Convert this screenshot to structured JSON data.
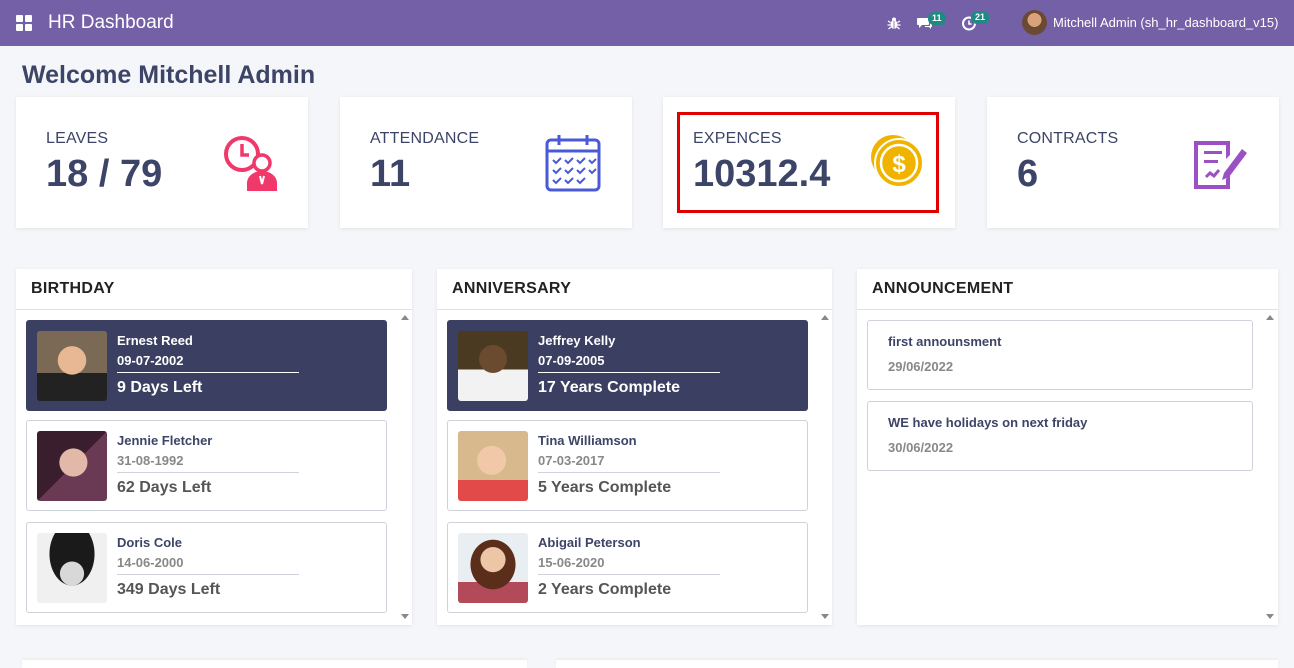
{
  "navbar": {
    "title": "HR Dashboard",
    "messages_count": "11",
    "activities_count": "21",
    "user": "Mitchell Admin (sh_hr_dashboard_v15)",
    "icons": [
      "apps-icon",
      "bug-icon",
      "chat-icon",
      "clock-icon"
    ]
  },
  "welcome": "Welcome Mitchell Admin",
  "stats": [
    {
      "label": "LEAVES",
      "value": "18 / 79",
      "icon": "leave-person-clock-icon",
      "color": "#f0386b"
    },
    {
      "label": "ATTENDANCE",
      "value": "11",
      "icon": "calendar-icon",
      "color": "#4a5ad6"
    },
    {
      "label": "EXPENCES",
      "value": "10312.4",
      "icon": "coin-dollar-icon",
      "color": "#f0b400"
    },
    {
      "label": "CONTRACTS",
      "value": "6",
      "icon": "contract-edit-icon",
      "color": "#9b51c4"
    }
  ],
  "birthday": {
    "title": "BIRTHDAY",
    "items": [
      {
        "name": "Ernest Reed",
        "date": "09-07-2002",
        "info": "9 Days Left"
      },
      {
        "name": "Jennie Fletcher",
        "date": "31-08-1992",
        "info": "62 Days Left"
      },
      {
        "name": "Doris Cole",
        "date": "14-06-2000",
        "info": "349 Days Left"
      }
    ]
  },
  "anniversary": {
    "title": "ANNIVERSARY",
    "items": [
      {
        "name": "Jeffrey Kelly",
        "date": "07-09-2005",
        "info": "17 Years Complete"
      },
      {
        "name": "Tina Williamson",
        "date": "07-03-2017",
        "info": "5 Years Complete"
      },
      {
        "name": "Abigail Peterson",
        "date": "15-06-2020",
        "info": "2 Years Complete"
      }
    ]
  },
  "announcement": {
    "title": "ANNOUNCEMENT",
    "items": [
      {
        "title": "first announsment",
        "date": "29/06/2022"
      },
      {
        "title": "WE have holidays on next friday",
        "date": "30/06/2022"
      }
    ]
  },
  "colors": {
    "navbar": "#7460a6",
    "active_card": "#3b4062",
    "highlight": "#e00000"
  }
}
